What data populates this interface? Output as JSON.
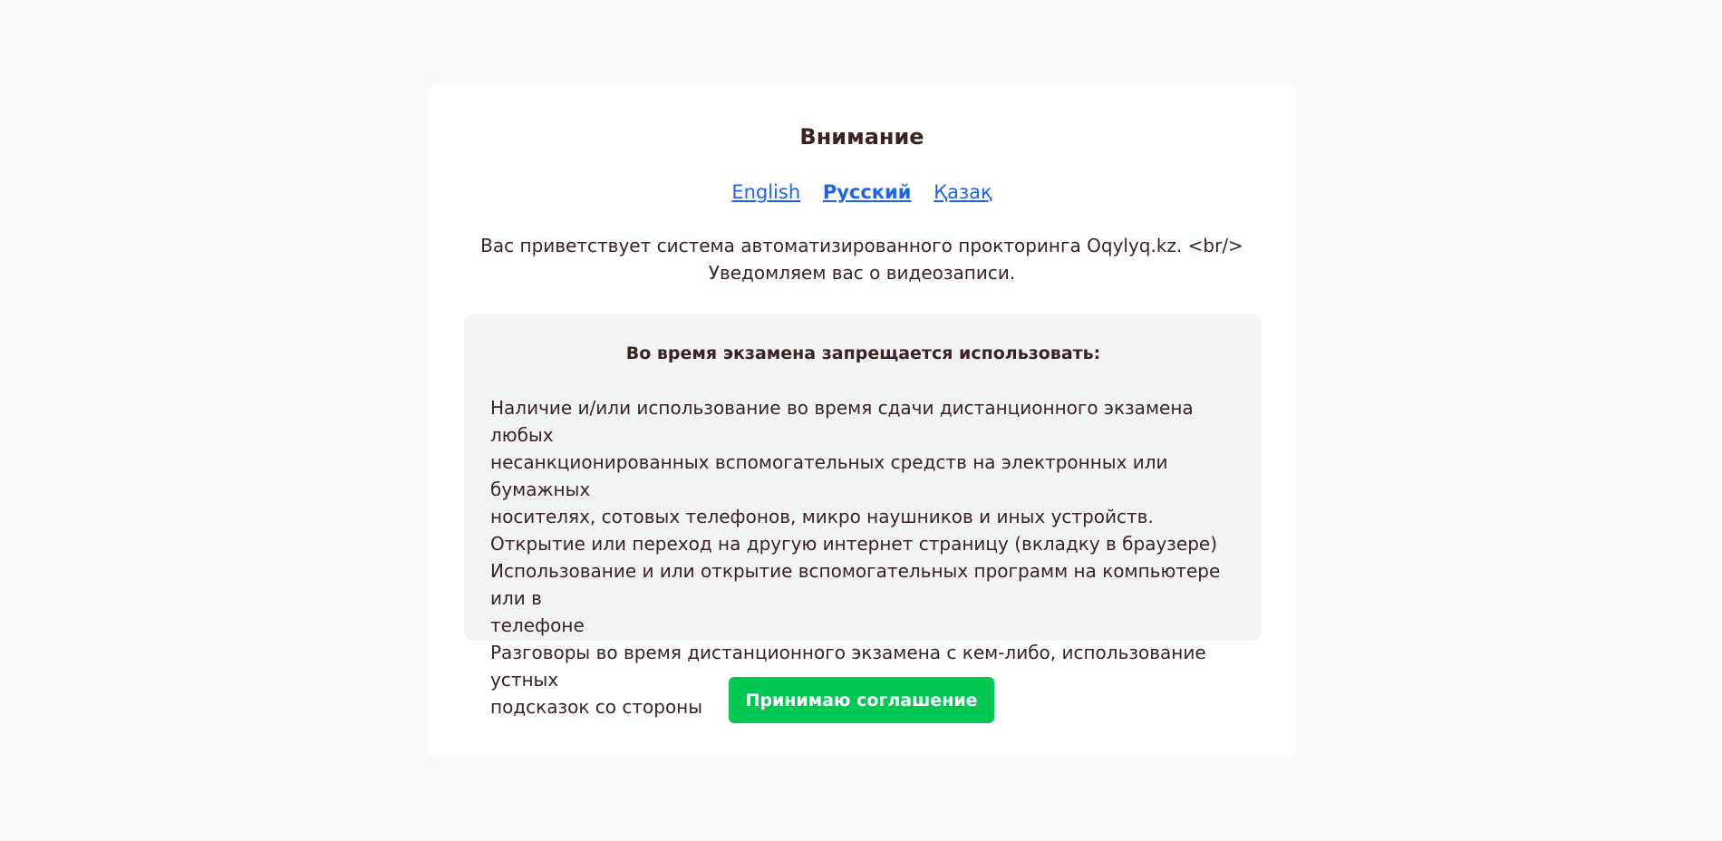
{
  "dialog": {
    "title": "Внимание",
    "languages": [
      {
        "label": "English",
        "active": false
      },
      {
        "label": "Русский",
        "active": true
      },
      {
        "label": "Қазақ",
        "active": false
      }
    ],
    "intro_line1": "Вас приветствует система автоматизированного прокторинга Oqylyq.kz. <br/>",
    "intro_line2": "Уведомляем вас о видеозаписи.",
    "rules": {
      "heading": "Во время экзамена запрещается использовать:",
      "lines": [
        "Наличие и/или использование во время сдачи дистанционного экзамена любых",
        "несанкционированных вспомогательных средств на электронных или бумажных",
        "носителях, сотовых телефонов, микро наушников и иных устройств.",
        "Открытие или переход на другую интернет страницу (вкладку в браузере)",
        "Использование и или открытие вспомогательных программ на компьютере или в",
        "телефоне",
        "Разговоры во время дистанционного экзамена с кем-либо, использование устных",
        "подсказок со стороны"
      ]
    },
    "accept_label": "Принимаю соглашение"
  },
  "colors": {
    "background": "#f9fafb",
    "link": "#1d64e8",
    "accept_button": "#00c853",
    "rules_panel": "#f2f3f5"
  }
}
